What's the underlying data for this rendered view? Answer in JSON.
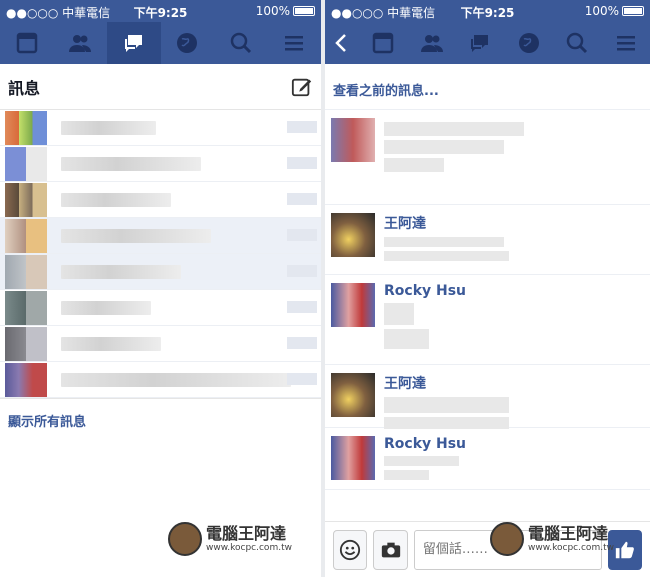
{
  "status": {
    "carrier": "●●○○○ 中華電信",
    "time": "下午9:25",
    "battery": "100%"
  },
  "left": {
    "title": "訊息",
    "show_all": "顯示所有訊息",
    "rows": 9
  },
  "right": {
    "see_previous": "查看之前的訊息...",
    "messages": [
      {
        "name": ""
      },
      {
        "name": "王阿達"
      },
      {
        "name": "Rocky Hsu"
      },
      {
        "name": "王阿達"
      },
      {
        "name": "Rocky Hsu"
      }
    ],
    "composer": {
      "placeholder": "留個話……"
    }
  },
  "watermark": {
    "brand": "電腦王阿達",
    "url": "www.kocpc.com.tw"
  },
  "colors": {
    "brand": "#3b5998",
    "nav_active": "#2e4a86"
  },
  "icons": [
    "news-feed-icon",
    "friends-icon",
    "messages-icon",
    "globe-icon",
    "search-icon",
    "menu-icon",
    "compose-icon",
    "back-icon",
    "emoji-icon",
    "camera-icon",
    "like-icon"
  ]
}
